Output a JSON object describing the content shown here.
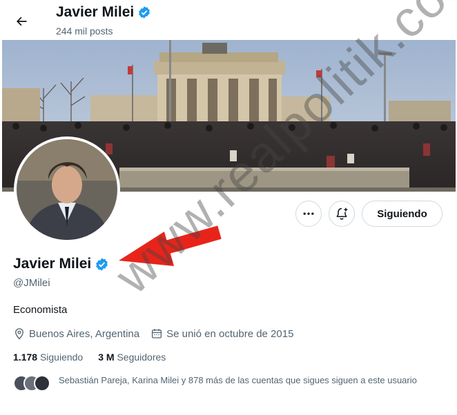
{
  "header": {
    "name": "Javier Milei",
    "posts": "244 mil posts"
  },
  "profile": {
    "name": "Javier Milei",
    "handle": "@JMilei",
    "bio": "Economista",
    "location": "Buenos Aires, Argentina",
    "joined": "Se unió en octubre de 2015",
    "following_count": "1.178",
    "following_label": "Siguiendo",
    "followers_count": "3 M",
    "followers_label": "Seguidores",
    "known_followers": "Sebastián Pareja, Karina Milei y 878 más de las cuentas que sigues siguen a este usuario"
  },
  "actions": {
    "more_icon": "more-icon",
    "notify_icon": "bell-plus-icon",
    "follow_label": "Siguiendo"
  },
  "watermark": "www.realpolitik.com.ar",
  "colors": {
    "verified": "#1d9bf0",
    "arrow": "#e8241a",
    "secondary_text": "#536471",
    "border": "#cfd9de"
  }
}
